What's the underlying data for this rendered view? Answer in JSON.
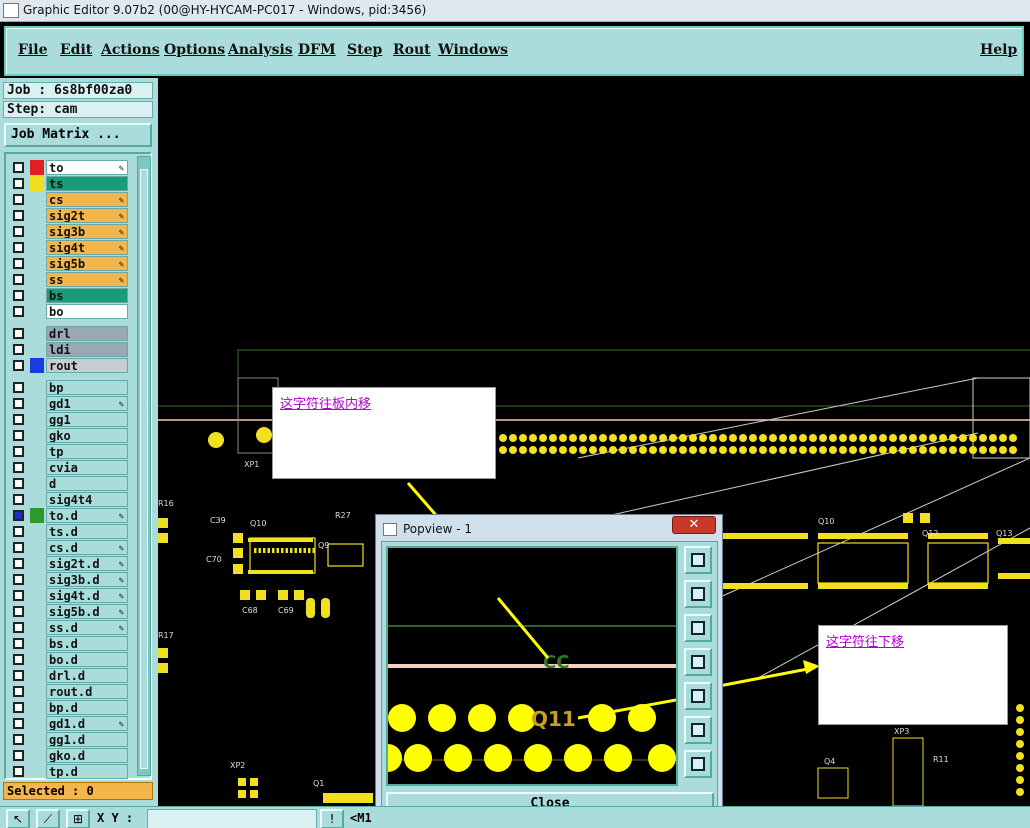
{
  "window": {
    "title": "Graphic Editor 9.07b2 (00@HY-HYCAM-PC017 - Windows, pid:3456)"
  },
  "menu": {
    "items": [
      "File",
      "Edit",
      "Actions",
      "Options",
      "Analysis",
      "DFM",
      "Step",
      "Rout",
      "Windows"
    ],
    "help": "Help"
  },
  "panel": {
    "job": "Job : 6s8bf00za0",
    "step": "Step: cam",
    "job_matrix": "Job Matrix ...",
    "selected": "Selected : 0"
  },
  "layers": [
    {
      "name": "to",
      "color": "#ffffff",
      "swatch": "#e02020",
      "edit": true,
      "checked": false
    },
    {
      "name": "ts",
      "color": "#1b9a78",
      "swatch": "#f0e020",
      "edit": false,
      "checked": false
    },
    {
      "name": "cs",
      "color": "#f4b64a",
      "swatch": "",
      "edit": true,
      "checked": false
    },
    {
      "name": "sig2t",
      "color": "#f4b64a",
      "swatch": "",
      "edit": true,
      "checked": false
    },
    {
      "name": "sig3b",
      "color": "#f4b64a",
      "swatch": "",
      "edit": true,
      "checked": false
    },
    {
      "name": "sig4t",
      "color": "#f4b64a",
      "swatch": "",
      "edit": true,
      "checked": false
    },
    {
      "name": "sig5b",
      "color": "#f4b64a",
      "swatch": "",
      "edit": true,
      "checked": false
    },
    {
      "name": "ss",
      "color": "#f4b64a",
      "swatch": "",
      "edit": true,
      "checked": false
    },
    {
      "name": "bs",
      "color": "#1b9a78",
      "swatch": "",
      "edit": false,
      "checked": false
    },
    {
      "name": "bo",
      "color": "#ffffff",
      "swatch": "",
      "edit": false,
      "checked": false
    },
    {
      "name": "drl",
      "color": "#9aa8b4",
      "swatch": "",
      "edit": false,
      "checked": false
    },
    {
      "name": "ldi",
      "color": "#9aa8b4",
      "swatch": "",
      "edit": false,
      "checked": false
    },
    {
      "name": "rout",
      "color": "#c8cdd4",
      "swatch": "#1a3be0",
      "edit": false,
      "checked": false
    },
    {
      "name": "bp",
      "color": "#a9dcda",
      "swatch": "",
      "edit": false,
      "checked": false
    },
    {
      "name": "gd1",
      "color": "#a9dcda",
      "swatch": "",
      "edit": true,
      "checked": false
    },
    {
      "name": "gg1",
      "color": "#a9dcda",
      "swatch": "",
      "edit": false,
      "checked": false
    },
    {
      "name": "gko",
      "color": "#a9dcda",
      "swatch": "",
      "edit": false,
      "checked": false
    },
    {
      "name": "tp",
      "color": "#a9dcda",
      "swatch": "",
      "edit": false,
      "checked": false
    },
    {
      "name": "cvia",
      "color": "#a9dcda",
      "swatch": "",
      "edit": false,
      "checked": false
    },
    {
      "name": "d",
      "color": "#a9dcda",
      "swatch": "",
      "edit": false,
      "checked": false
    },
    {
      "name": "sig4t4",
      "color": "#a9dcda",
      "swatch": "",
      "edit": false,
      "checked": false
    },
    {
      "name": "to.d",
      "color": "#a9dcda",
      "swatch": "#2a9a2a",
      "edit": true,
      "checked": true
    },
    {
      "name": "ts.d",
      "color": "#a9dcda",
      "swatch": "",
      "edit": false,
      "checked": false
    },
    {
      "name": "cs.d",
      "color": "#a9dcda",
      "swatch": "",
      "edit": true,
      "checked": false
    },
    {
      "name": "sig2t.d",
      "color": "#a9dcda",
      "swatch": "",
      "edit": true,
      "checked": false
    },
    {
      "name": "sig3b.d",
      "color": "#a9dcda",
      "swatch": "",
      "edit": true,
      "checked": false
    },
    {
      "name": "sig4t.d",
      "color": "#a9dcda",
      "swatch": "",
      "edit": true,
      "checked": false
    },
    {
      "name": "sig5b.d",
      "color": "#a9dcda",
      "swatch": "",
      "edit": true,
      "checked": false
    },
    {
      "name": "ss.d",
      "color": "#a9dcda",
      "swatch": "",
      "edit": true,
      "checked": false
    },
    {
      "name": "bs.d",
      "color": "#a9dcda",
      "swatch": "",
      "edit": false,
      "checked": false
    },
    {
      "name": "bo.d",
      "color": "#a9dcda",
      "swatch": "",
      "edit": false,
      "checked": false
    },
    {
      "name": "drl.d",
      "color": "#a9dcda",
      "swatch": "",
      "edit": false,
      "checked": false
    },
    {
      "name": "rout.d",
      "color": "#a9dcda",
      "swatch": "",
      "edit": false,
      "checked": false
    },
    {
      "name": "bp.d",
      "color": "#a9dcda",
      "swatch": "",
      "edit": false,
      "checked": false
    },
    {
      "name": "gd1.d",
      "color": "#a9dcda",
      "swatch": "",
      "edit": true,
      "checked": false
    },
    {
      "name": "gg1.d",
      "color": "#a9dcda",
      "swatch": "",
      "edit": false,
      "checked": false
    },
    {
      "name": "gko.d",
      "color": "#a9dcda",
      "swatch": "",
      "edit": false,
      "checked": false
    },
    {
      "name": "tp.d",
      "color": "#a9dcda",
      "swatch": "",
      "edit": false,
      "checked": false
    }
  ],
  "statusbar": {
    "xy_label": "X Y :",
    "msg": "<M1"
  },
  "canvas": {
    "refdes": [
      "XP1",
      "C39",
      "Q10",
      "R27",
      "Q9",
      "C70",
      "C68",
      "C69",
      "R16",
      "R17",
      "XP2",
      "Q1",
      "Q10",
      "Q12",
      "Q13",
      "XP3",
      "Q4",
      "R11"
    ]
  },
  "notes": {
    "note1": "这字符往板内移",
    "note2": "这字符往下移"
  },
  "popview": {
    "title": "Popview - 1",
    "close_x": "✕",
    "close_label": "Close",
    "text_cc": "CC",
    "text_q11": "Q11"
  }
}
